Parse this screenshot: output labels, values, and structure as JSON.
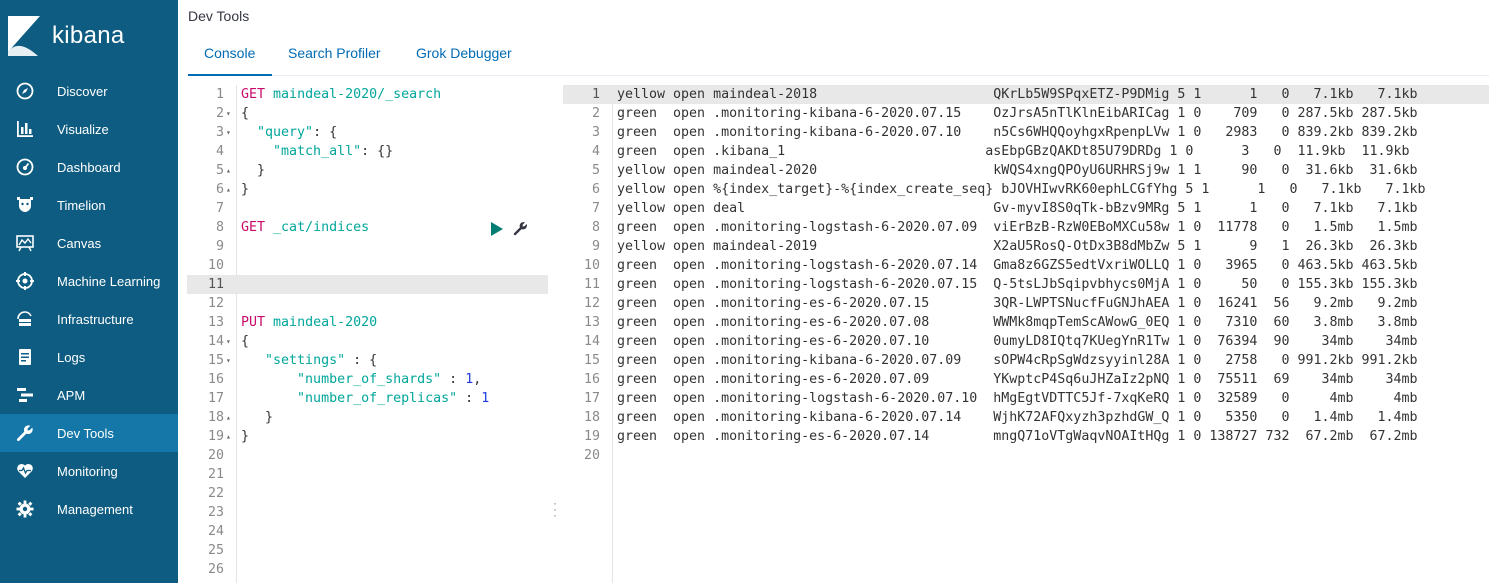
{
  "sidebar": {
    "brand": "kibana",
    "items": [
      {
        "label": "Discover",
        "icon": "compass-icon"
      },
      {
        "label": "Visualize",
        "icon": "bar-chart-icon"
      },
      {
        "label": "Dashboard",
        "icon": "dashboard-icon"
      },
      {
        "label": "Timelion",
        "icon": "timelion-icon"
      },
      {
        "label": "Canvas",
        "icon": "canvas-icon"
      },
      {
        "label": "Machine Learning",
        "icon": "ml-icon"
      },
      {
        "label": "Infrastructure",
        "icon": "infrastructure-icon"
      },
      {
        "label": "Logs",
        "icon": "logs-icon"
      },
      {
        "label": "APM",
        "icon": "apm-icon"
      },
      {
        "label": "Dev Tools",
        "icon": "wrench-icon",
        "active": true
      },
      {
        "label": "Monitoring",
        "icon": "heartbeat-icon"
      },
      {
        "label": "Management",
        "icon": "gear-icon"
      }
    ],
    "colors": {
      "background": "#0e5c81",
      "active": "#1477a7"
    }
  },
  "header": {
    "title": "Dev Tools",
    "tabs": [
      {
        "label": "Console",
        "active": true
      },
      {
        "label": "Search Profiler"
      },
      {
        "label": "Grok Debugger"
      }
    ]
  },
  "editor": {
    "lines": [
      {
        "num": "1",
        "fold": "",
        "text": "GET maindeal-2020/_search"
      },
      {
        "num": "2",
        "fold": "▾",
        "text": "{"
      },
      {
        "num": "3",
        "fold": "▾",
        "text": "  \"query\": {"
      },
      {
        "num": "4",
        "fold": "",
        "text": "    \"match_all\": {}"
      },
      {
        "num": "5",
        "fold": "▴",
        "text": "  }"
      },
      {
        "num": "6",
        "fold": "▴",
        "text": "}"
      },
      {
        "num": "7",
        "fold": "",
        "text": ""
      },
      {
        "num": "8",
        "fold": "",
        "text": "GET _cat/indices"
      },
      {
        "num": "9",
        "fold": "",
        "text": ""
      },
      {
        "num": "10",
        "fold": "",
        "text": ""
      },
      {
        "num": "11",
        "fold": "",
        "text": "",
        "highlight": true
      },
      {
        "num": "12",
        "fold": "",
        "text": ""
      },
      {
        "num": "13",
        "fold": "",
        "text": "PUT maindeal-2020"
      },
      {
        "num": "14",
        "fold": "▾",
        "text": "{"
      },
      {
        "num": "15",
        "fold": "▾",
        "text": "   \"settings\" : {"
      },
      {
        "num": "16",
        "fold": "",
        "text": "       \"number_of_shards\" : 1,"
      },
      {
        "num": "17",
        "fold": "",
        "text": "       \"number_of_replicas\" : 1"
      },
      {
        "num": "18",
        "fold": "▴",
        "text": "   }"
      },
      {
        "num": "19",
        "fold": "▴",
        "text": "}"
      },
      {
        "num": "20",
        "fold": "",
        "text": ""
      },
      {
        "num": "21",
        "fold": "",
        "text": ""
      },
      {
        "num": "22",
        "fold": "",
        "text": ""
      },
      {
        "num": "23",
        "fold": "",
        "text": ""
      },
      {
        "num": "24",
        "fold": "",
        "text": ""
      },
      {
        "num": "25",
        "fold": "",
        "text": ""
      },
      {
        "num": "26",
        "fold": "",
        "text": ""
      }
    ],
    "colors": {
      "method": "#c80a68",
      "url": "#00a69b",
      "key": "#00a69b",
      "number": "#1f3ce0"
    }
  },
  "output": {
    "lines": [
      {
        "num": "1",
        "text": "yellow open maindeal-2018                      QKrLb5W9SPqxETZ-P9DMig 5 1      1   0   7.1kb   7.1kb",
        "highlight": true
      },
      {
        "num": "2",
        "text": "green  open .monitoring-kibana-6-2020.07.15    OzJrsA5nTlKlnEibARICag 1 0    709   0 287.5kb 287.5kb"
      },
      {
        "num": "3",
        "text": "green  open .monitoring-kibana-6-2020.07.10    n5Cs6WHQQoyhgxRpenpLVw 1 0   2983   0 839.2kb 839.2kb"
      },
      {
        "num": "4",
        "text": "green  open .kibana_1                         asEbpGBzQAKDt85U79DRDg 1 0      3   0  11.9kb  11.9kb"
      },
      {
        "num": "5",
        "text": "yellow open maindeal-2020                      kWQS4xngQPOyU6URHRSj9w 1 1     90   0  31.6kb  31.6kb"
      },
      {
        "num": "6",
        "text": "yellow open %{index_target}-%{index_create_seq} bJOVHIwvRK60ephLCGfYhg 5 1      1   0   7.1kb   7.1kb"
      },
      {
        "num": "7",
        "text": "yellow open deal                               Gv-myvI8S0qTk-bBzv9MRg 5 1      1   0   7.1kb   7.1kb"
      },
      {
        "num": "8",
        "text": "green  open .monitoring-logstash-6-2020.07.09  viErBzB-RzW0EBoMXCu58w 1 0  11778   0   1.5mb   1.5mb"
      },
      {
        "num": "9",
        "text": "yellow open maindeal-2019                      X2aU5RosQ-OtDx3B8dMbZw 5 1      9   1  26.3kb  26.3kb"
      },
      {
        "num": "10",
        "text": "green  open .monitoring-logstash-6-2020.07.14  Gma8z6GZS5edtVxriWOLLQ 1 0   3965   0 463.5kb 463.5kb"
      },
      {
        "num": "11",
        "text": "green  open .monitoring-logstash-6-2020.07.15  Q-5tsLJbSqipvbhycs0MjA 1 0     50   0 155.3kb 155.3kb"
      },
      {
        "num": "12",
        "text": "green  open .monitoring-es-6-2020.07.15        3QR-LWPTSNucfFuGNJhAEA 1 0  16241  56   9.2mb   9.2mb"
      },
      {
        "num": "13",
        "text": "green  open .monitoring-es-6-2020.07.08        WWMk8mqpTemScAWowG_0EQ 1 0   7310  60   3.8mb   3.8mb"
      },
      {
        "num": "14",
        "text": "green  open .monitoring-es-6-2020.07.10        0umyLD8IQtq7KUegYnR1Tw 1 0  76394  90    34mb    34mb"
      },
      {
        "num": "15",
        "text": "green  open .monitoring-kibana-6-2020.07.09    sOPW4cRpSgWdzsyyinl28A 1 0   2758   0 991.2kb 991.2kb"
      },
      {
        "num": "16",
        "text": "green  open .monitoring-es-6-2020.07.09        YKwptcP4Sq6uJHZaIz2pNQ 1 0  75511  69    34mb    34mb"
      },
      {
        "num": "17",
        "text": "green  open .monitoring-logstash-6-2020.07.10  hMgEgtVDTTC5Jf-7xqKeRQ 1 0  32589   0     4mb     4mb"
      },
      {
        "num": "18",
        "text": "green  open .monitoring-kibana-6-2020.07.14    WjhK72AFQxyzh3pzhdGW_Q 1 0   5350   0   1.4mb   1.4mb"
      },
      {
        "num": "19",
        "text": "green  open .monitoring-es-6-2020.07.14        mngQ71oVTgWaqvNOAItHQg 1 0 138727 732  67.2mb  67.2mb"
      },
      {
        "num": "20",
        "text": ""
      }
    ]
  }
}
